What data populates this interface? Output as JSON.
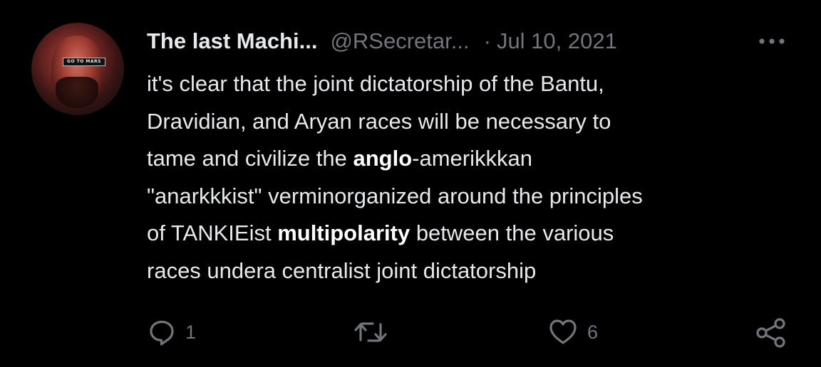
{
  "tweet": {
    "avatar_sticker_text": "GO TO MARS",
    "author_name": "The last Machi...",
    "author_handle": "@RSecretar...",
    "separator": "·",
    "date": "Jul 10, 2021",
    "body": {
      "line1": "it's clear that the joint dictatorship of the Bantu,",
      "line2": "Dravidian, and Aryan races will be necessary to",
      "line3_pre": "tame and civilize the ",
      "line3_bold": "anglo",
      "line3_post": "-amerikkkan",
      "line4": "\"anarkkkist\" verminorganized around the principles",
      "line5_pre": "of TANKIEist ",
      "line5_bold": "multipolarity",
      "line5_post": " between the various",
      "line6": "races undera centralist joint dictatorship"
    },
    "actions": {
      "reply_icon": "reply-icon",
      "reply_count": "1",
      "retweet_icon": "retweet-icon",
      "like_icon": "heart-icon",
      "like_count": "6",
      "share_icon": "share-icon"
    },
    "colors": {
      "background": "#000000",
      "primary_text": "#e7e9ea",
      "secondary_text": "#71767b"
    }
  }
}
